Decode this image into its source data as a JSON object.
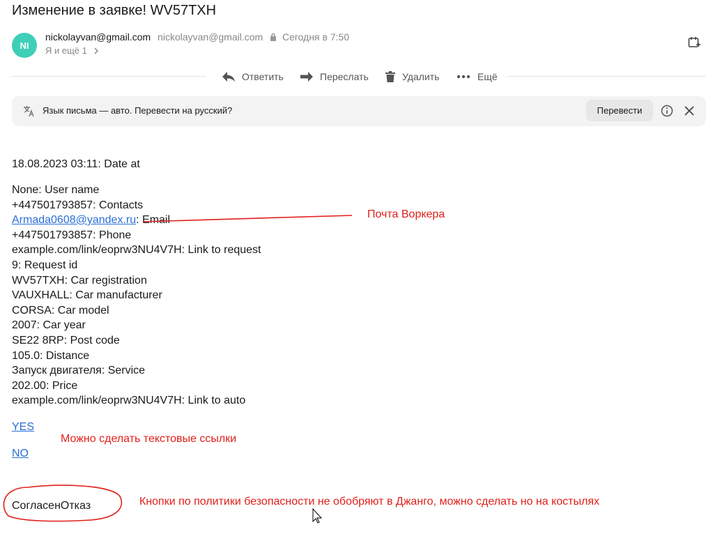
{
  "email": {
    "subject": "Изменение в заявке! WV57TXH",
    "avatar_initials": "NI",
    "avatar_color": "#3ecfb8",
    "sender_name": "nickolayvan@gmail.com",
    "sender_address": "nickolayvan@gmail.com",
    "time": "Сегодня в 7:50",
    "recipients": "Я и ещё 1"
  },
  "toolbar": {
    "reply": "Ответить",
    "forward": "Переслать",
    "delete": "Удалить",
    "more": "Ещё"
  },
  "translate": {
    "message": "Язык письма — авто. Перевести на русский?",
    "button": "Перевести"
  },
  "body": {
    "date_line": "18.08.2023 03:11: Date at",
    "user_name": "None: User name",
    "contacts": "+447501793857: Contacts",
    "email_link": "Armada0608@yandex.ru",
    "email_suffix": ": Email",
    "phone": "+447501793857: Phone",
    "link_request": "example.com/link/eoprw3NU4V7H: Link to request",
    "request_id": "9: Request id",
    "car_registration": "WV57TXH: Car registration",
    "car_manufacturer": "VAUXHALL: Car manufacturer",
    "car_model": "CORSA: Car model",
    "car_year": "2007: Car year",
    "post_code": "SE22 8RP: Post code",
    "distance": "105.0: Distance",
    "service": "Запуск двигателя: Service",
    "price": "202.00: Price",
    "link_auto": "example.com/link/eoprw3NU4V7H: Link to auto",
    "yes_link": "YES",
    "no_link": "NO",
    "buttons_text": "СогласенОтказ"
  },
  "annotations": {
    "worker_email": "Почта Воркера",
    "text_links": "Можно сделать текстовые ссылки",
    "buttons_note": "Кнопки по политики безопасности не обобряют в Джанго, можно сделать но на костылях",
    "color": "#e0201b"
  }
}
